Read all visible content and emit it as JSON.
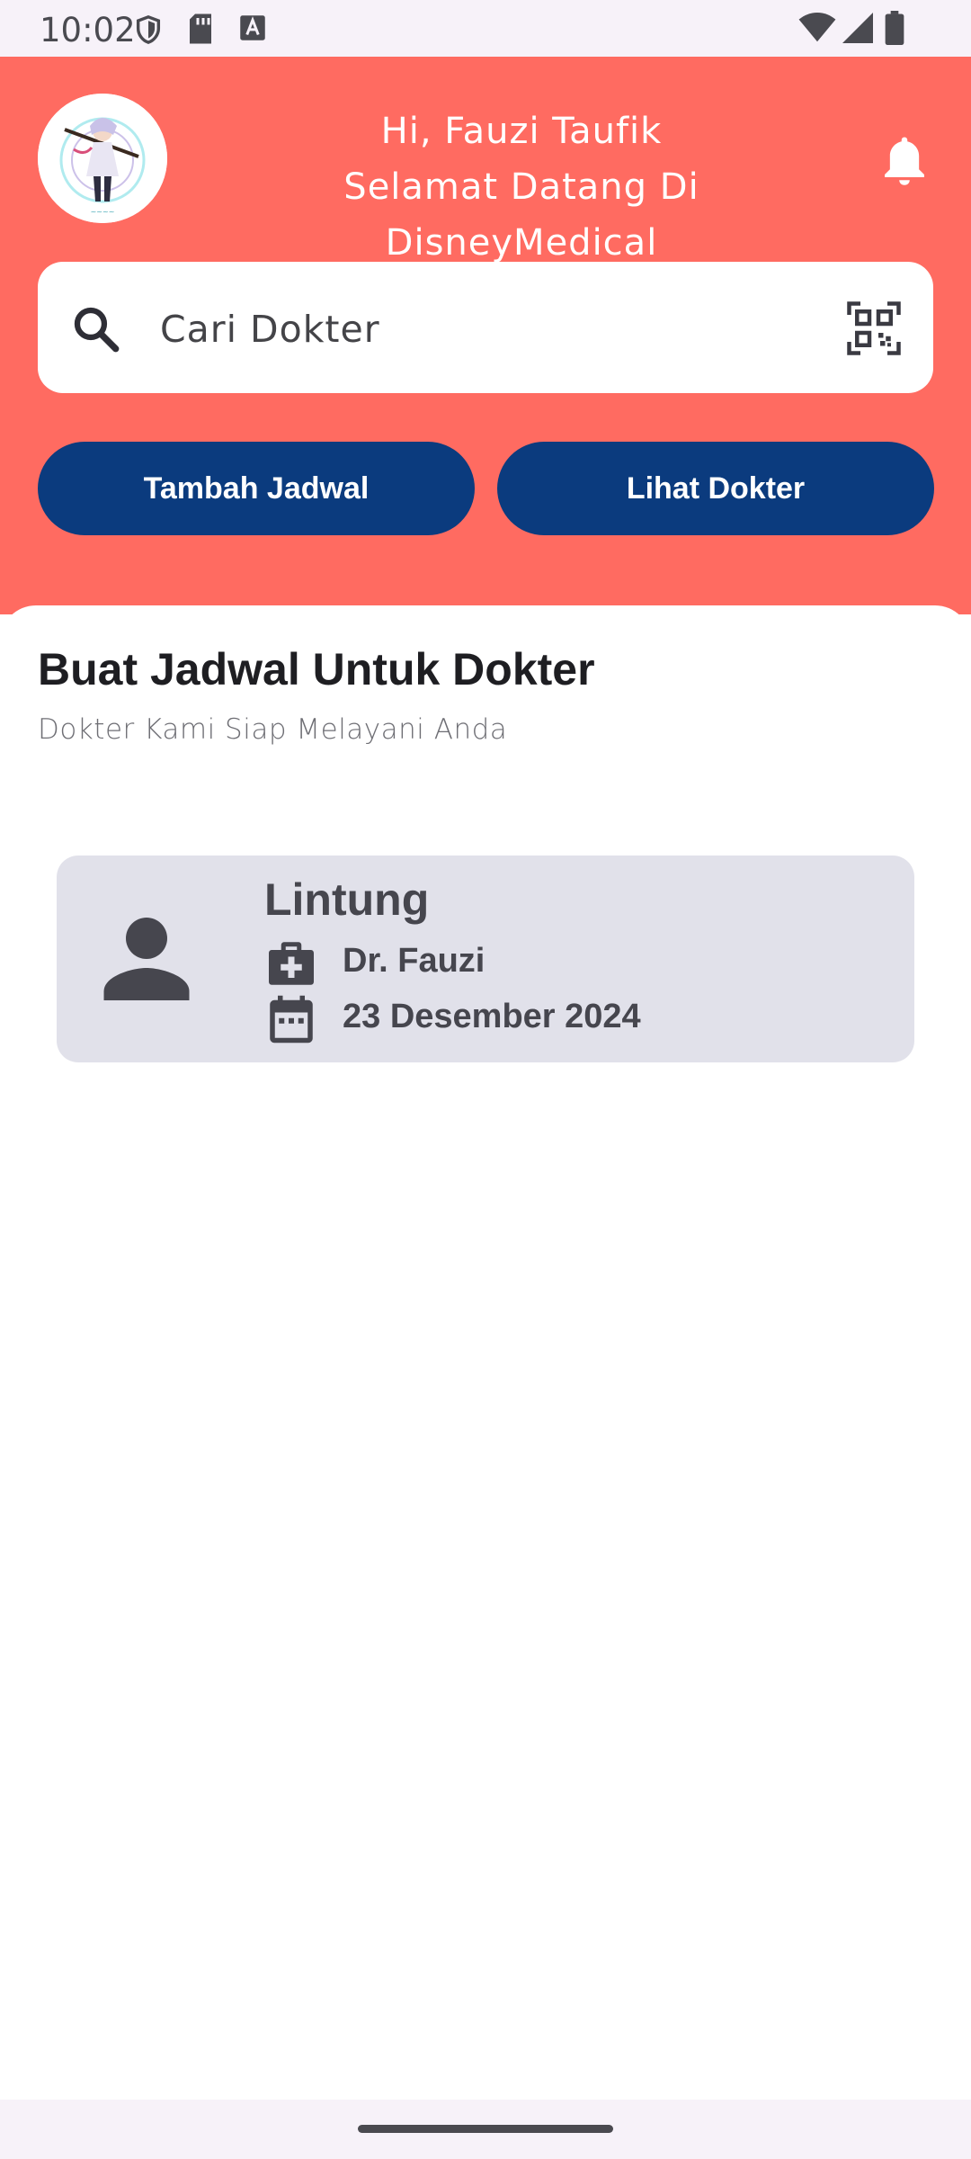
{
  "status_bar": {
    "time": "10:02",
    "left_icons": [
      "shield-icon",
      "sd-card-icon",
      "keyboard-a-icon"
    ],
    "right_icons": [
      "wifi-icon",
      "signal-icon",
      "battery-icon"
    ]
  },
  "header": {
    "greeting": "Hi, Fauzi Taufik",
    "welcome": "Selamat Datang Di DisneyMedical",
    "background_color": "#FF6B61",
    "avatar": "profile-avatar",
    "notification_icon": "bell-icon"
  },
  "search": {
    "placeholder": "Cari Dokter",
    "icon": "search-icon",
    "scan_icon": "qr-scan-icon"
  },
  "actions": {
    "add_schedule": "Tambah Jadwal",
    "view_doctors": "Lihat Dokter",
    "button_color": "#0B3B7E"
  },
  "section": {
    "title": "Buat Jadwal Untuk Dokter",
    "subtitle": "Dokter Kami Siap Melayani Anda"
  },
  "appointments": [
    {
      "patient": "Lintung",
      "doctor": "Dr. Fauzi",
      "date": "23 Desember 2024",
      "icons": [
        "person-icon",
        "medical-bag-icon",
        "calendar-icon"
      ]
    }
  ]
}
